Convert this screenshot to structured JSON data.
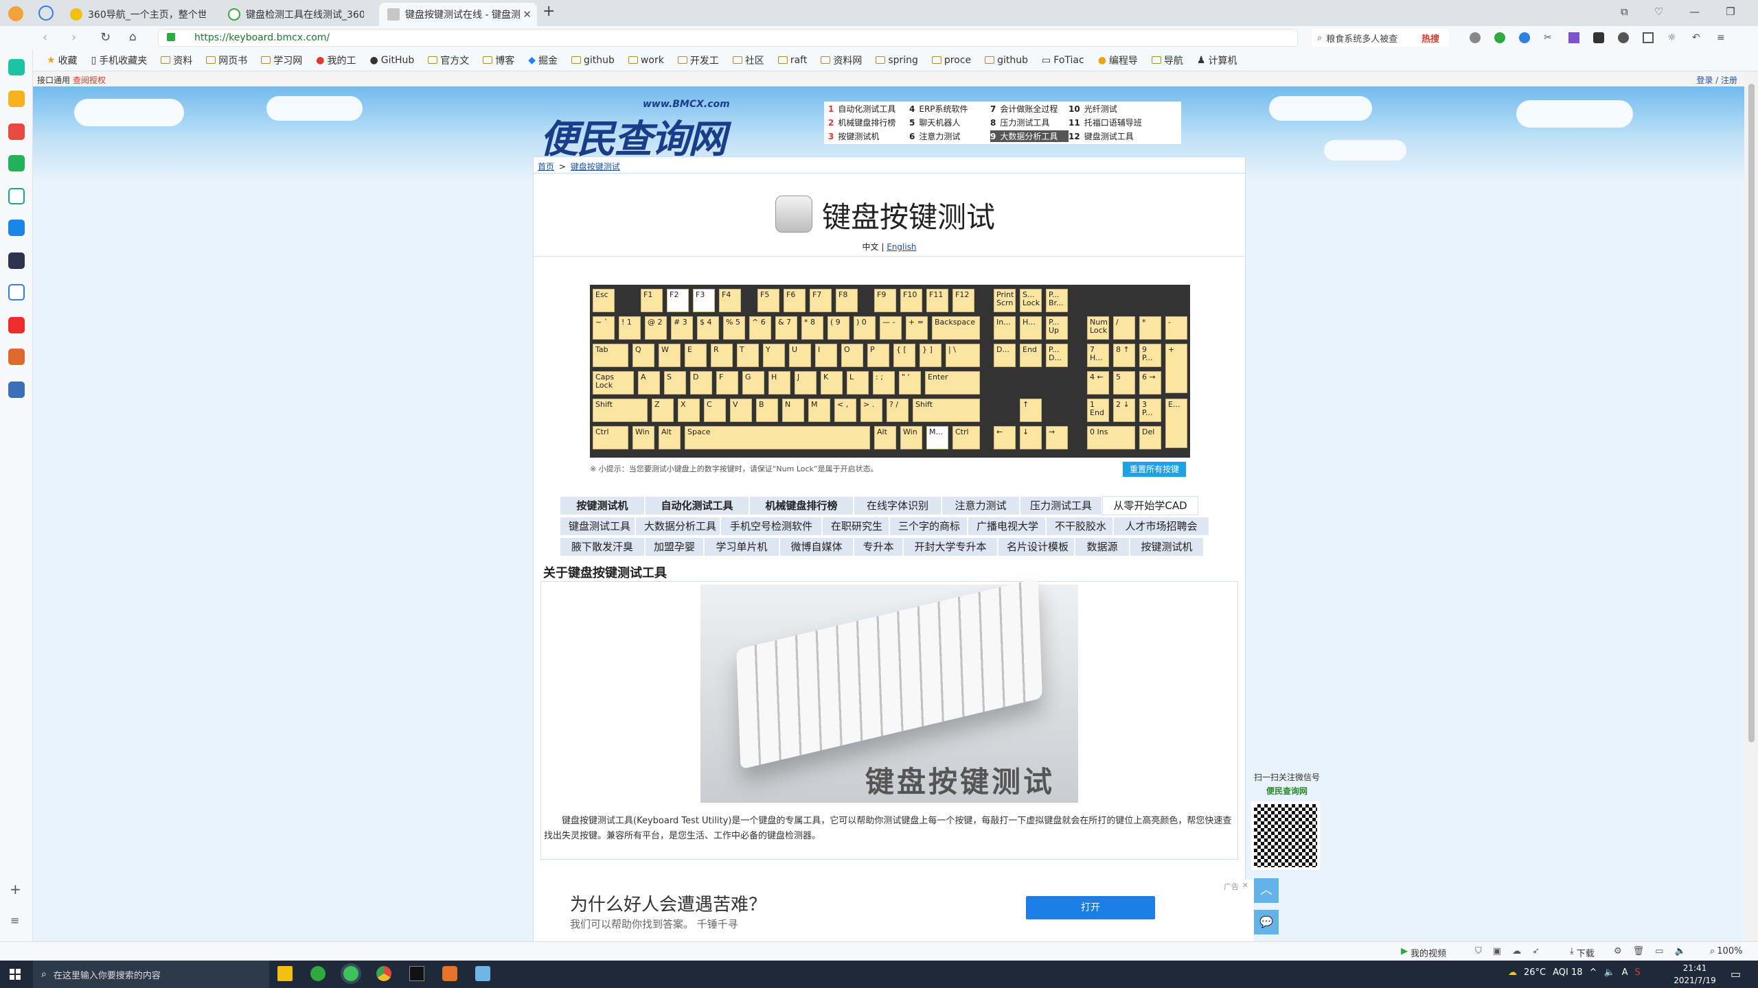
{
  "browser": {
    "tabs": [
      {
        "label": "360导航_一个主页，整个世",
        "color": "#f2c010"
      },
      {
        "label": "键盘检测工具在线测试_360",
        "color": "#2eaa3e"
      },
      {
        "label": "键盘按键测试在线 - 键盘测",
        "color": "#c7c7c7",
        "active": true
      }
    ],
    "new_tab": "+",
    "url": "https://keyboard.bmcx.com/",
    "search_hint": "粮食系统多人被查",
    "hot_label": "热搜",
    "bookmarks": [
      "收藏",
      "手机收藏夹",
      "资料",
      "网页书",
      "学习网",
      "我的工",
      "GitHub",
      "官方文",
      "博客",
      "掘金",
      "github",
      "work",
      "开发工",
      "社区",
      "raft",
      "资料网",
      "spring",
      "proce",
      "github",
      "FoTiac",
      "编程导",
      "导航",
      "计算机"
    ],
    "infobar_left": "接口通用",
    "infobar_link": "查阅授权",
    "infobar_right": "登录 / 注册"
  },
  "site": {
    "logo_url": "www.BMCX.com",
    "logo_text": "便民查询网",
    "top_links": [
      {
        "num": "1",
        "text": "自动化测试工具"
      },
      {
        "num": "4",
        "text": "ERP系统软件"
      },
      {
        "num": "7",
        "text": "会计做账全过程"
      },
      {
        "num": "10",
        "text": "光纤测试"
      },
      {
        "num": "2",
        "text": "机械键盘排行榜"
      },
      {
        "num": "5",
        "text": "聊天机器人"
      },
      {
        "num": "8",
        "text": "压力测试工具"
      },
      {
        "num": "11",
        "text": "托福口语辅导班"
      },
      {
        "num": "3",
        "text": "按键测试机"
      },
      {
        "num": "6",
        "text": "注意力测试"
      },
      {
        "num": "9",
        "text": "大数据分析工具",
        "highlight": true
      },
      {
        "num": "12",
        "text": "键盘测试工具"
      }
    ],
    "breadcrumb_home": "首页",
    "breadcrumb_sep": ">",
    "breadcrumb_current": "键盘按键测试",
    "page_title": "键盘按键测试",
    "lang_zh": "中文",
    "lang_sep": "|",
    "lang_en": "English",
    "tip": "※ 小提示：当您要测试小键盘上的数字按键时，请保证“Num Lock”是属于开启状态。",
    "reset_button": "重置所有按键",
    "nav_rows": [
      [
        "按键测试机",
        "自动化测试工具",
        "机械键盘排行榜",
        "在线字体识别",
        "注意力测试",
        "压力测试工具",
        "从零开始学CAD"
      ],
      [
        "键盘测试工具",
        "大数据分析工具",
        "手机空号检测软件",
        "在职研究生",
        "三个字的商标",
        "广播电视大学",
        "不干胶胶水",
        "人才市场招聘会"
      ],
      [
        "腋下散发汗臭",
        "加盟孕婴",
        "学习单片机",
        "微博自媒体",
        "专升本",
        "开封大学专升本",
        "名片设计模板",
        "数据源",
        "按键测试机"
      ]
    ],
    "about_title": "关于键盘按键测试工具",
    "image_caption": "键盘按键测试",
    "description": "键盘按键测试工具(Keyboard Test Utility)是一个键盘的专属工具，它可以帮助你测试键盘上每一个按键，每敲打一下虚拟键盘就会在所打的键位上高亮颜色，帮您快速查找出失灵按键。兼容所有平台，是您生活、工作中必备的键盘检测器。",
    "qr_title": "扫一扫关注微信号",
    "qr_name": "便民查询网",
    "ad_label": "广告",
    "ad_close": "✕",
    "ad_title": "为什么好人会遭遇苦难？",
    "ad_sub": "我们可以帮助你找到答案。 千锤千寻",
    "ad_button": "打开"
  },
  "keyboard": {
    "keys": [
      {
        "l": "Esc"
      },
      {
        "l": "F1"
      },
      {
        "l": "F2",
        "p": true
      },
      {
        "l": "F3",
        "p": true
      },
      {
        "l": "F4"
      },
      {
        "l": "F5"
      },
      {
        "l": "F6"
      },
      {
        "l": "F7"
      },
      {
        "l": "F8"
      },
      {
        "l": "F9"
      },
      {
        "l": "F10"
      },
      {
        "l": "F11"
      },
      {
        "l": "F12"
      },
      {
        "l": "Print Scrn"
      },
      {
        "l": "S... Lock"
      },
      {
        "l": "P... Br..."
      },
      {
        "l": "~ `"
      },
      {
        "l": "! 1"
      },
      {
        "l": "@ 2"
      },
      {
        "l": "# 3"
      },
      {
        "l": "$ 4"
      },
      {
        "l": "% 5"
      },
      {
        "l": "^ 6"
      },
      {
        "l": "& 7"
      },
      {
        "l": "* 8"
      },
      {
        "l": "( 9"
      },
      {
        "l": ") 0"
      },
      {
        "l": "— -"
      },
      {
        "l": "+ ="
      },
      {
        "l": "Backspace"
      },
      {
        "l": "In..."
      },
      {
        "l": "H..."
      },
      {
        "l": "P... Up"
      },
      {
        "l": "Num Lock"
      },
      {
        "l": "/"
      },
      {
        "l": "*"
      },
      {
        "l": "-"
      },
      {
        "l": "Tab"
      },
      {
        "l": "Q"
      },
      {
        "l": "W"
      },
      {
        "l": "E"
      },
      {
        "l": "R"
      },
      {
        "l": "T"
      },
      {
        "l": "Y"
      },
      {
        "l": "U"
      },
      {
        "l": "I"
      },
      {
        "l": "O"
      },
      {
        "l": "P"
      },
      {
        "l": "{ ["
      },
      {
        "l": "} ]"
      },
      {
        "l": "| \\"
      },
      {
        "l": "D..."
      },
      {
        "l": "End"
      },
      {
        "l": "P... D..."
      },
      {
        "l": "7 H..."
      },
      {
        "l": "8 ↑"
      },
      {
        "l": "9 P..."
      },
      {
        "l": "+"
      },
      {
        "l": "Caps Lock"
      },
      {
        "l": "A"
      },
      {
        "l": "S"
      },
      {
        "l": "D"
      },
      {
        "l": "F"
      },
      {
        "l": "G"
      },
      {
        "l": "H"
      },
      {
        "l": "J"
      },
      {
        "l": "K"
      },
      {
        "l": "L"
      },
      {
        "l": ": ;"
      },
      {
        "l": "\" '"
      },
      {
        "l": "Enter"
      },
      {
        "l": "4 ←"
      },
      {
        "l": "5"
      },
      {
        "l": "6 →"
      },
      {
        "l": "Shift"
      },
      {
        "l": "Z"
      },
      {
        "l": "X"
      },
      {
        "l": "C"
      },
      {
        "l": "V"
      },
      {
        "l": "B"
      },
      {
        "l": "N"
      },
      {
        "l": "M"
      },
      {
        "l": "< ,"
      },
      {
        "l": "> ."
      },
      {
        "l": "? /"
      },
      {
        "l": "Shift"
      },
      {
        "l": "↑"
      },
      {
        "l": "1 End"
      },
      {
        "l": "2 ↓"
      },
      {
        "l": "3 P..."
      },
      {
        "l": "E..."
      },
      {
        "l": "Ctrl"
      },
      {
        "l": "Win"
      },
      {
        "l": "Alt"
      },
      {
        "l": "Space"
      },
      {
        "l": "Alt"
      },
      {
        "l": "Win"
      },
      {
        "l": "M...",
        "p": true
      },
      {
        "l": "Ctrl"
      },
      {
        "l": "←"
      },
      {
        "l": "↓"
      },
      {
        "l": "→"
      },
      {
        "l": "0 Ins"
      },
      {
        "l": "Del"
      }
    ]
  },
  "status": {
    "my_video": "我的视频",
    "download": "下载",
    "zoom": "100%",
    "weather": "26°C",
    "aqi": "AQI 18",
    "ime": "A",
    "time": "21:41",
    "date": "2021/7/19",
    "search_placeholder": "在这里输入你要搜索的内容"
  }
}
